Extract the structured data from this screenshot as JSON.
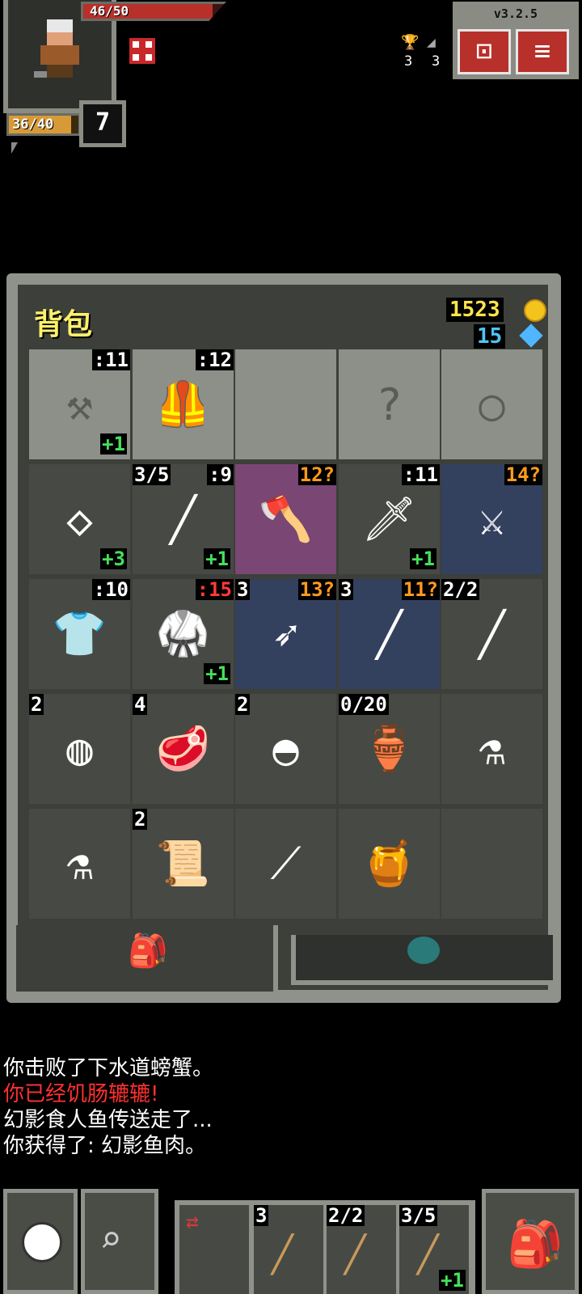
{
  "hud": {
    "hp": "46/50",
    "hp_fraction": 0.92,
    "xp": "36/40",
    "xp_fraction": 0.9,
    "depth": "7",
    "version": "v3.2.5",
    "stat_a_value": "3",
    "stat_b_value": "3",
    "icons": {
      "portrait": "hero-portrait",
      "buff": "hunger-buff-icon",
      "journal": "journal-icon",
      "menu": "menu-icon",
      "trophy": "trophy-icon",
      "stairs": "stairs-icon"
    }
  },
  "backpack": {
    "title": "背包",
    "gold": "1523",
    "gems": "15",
    "rows": [
      [
        {
          "name": "sickle",
          "icon": "⚒",
          "tr": ":11",
          "tr_color": "w",
          "br": "+1",
          "bg": "equip"
        },
        {
          "name": "leather-armor",
          "icon": "🦺",
          "tr": ":12",
          "tr_color": "w",
          "bg": "equip"
        },
        {
          "name": "empty-artifact",
          "icon": "",
          "bg": "equip"
        },
        {
          "name": "empty-misc",
          "icon": "?",
          "bg": "equip"
        },
        {
          "name": "empty-ring",
          "icon": "○",
          "bg": "equip"
        }
      ],
      [
        {
          "name": "ring",
          "icon": "◇",
          "br": "+3",
          "bg": "normal"
        },
        {
          "name": "staff",
          "icon": "╱",
          "tl": "3/5",
          "tr": ":9",
          "tr_color": "w",
          "br": "+1",
          "bg": "normal"
        },
        {
          "name": "hand-axe",
          "icon": "🪓",
          "tr": "12?",
          "tr_color": "o",
          "bg": "purple"
        },
        {
          "name": "shortsword",
          "icon": "🗡",
          "tr": ":11",
          "tr_color": "w",
          "br": "+1",
          "bg": "normal"
        },
        {
          "name": "scimitar",
          "icon": "⚔",
          "tr": "14?",
          "tr_color": "o",
          "bg": "blue"
        }
      ],
      [
        {
          "name": "cloth-armor",
          "icon": "👕",
          "tr": ":10",
          "tr_color": "w",
          "bg": "normal"
        },
        {
          "name": "scale-armor",
          "icon": "🥋",
          "tr": ":15",
          "tr_color": "r",
          "br": "+1",
          "bg": "normal"
        },
        {
          "name": "javelins",
          "icon": "➶",
          "tl": "3",
          "tr": "13?",
          "tr_color": "o",
          "bg": "blue"
        },
        {
          "name": "throwing-knives",
          "icon": "╱",
          "tl": "3",
          "tr": "11?",
          "tr_color": "o",
          "bg": "blue"
        },
        {
          "name": "darts",
          "icon": "╱",
          "tl": "2/2",
          "bg": "normal"
        }
      ],
      [
        {
          "name": "stones",
          "icon": "◍",
          "tl": "2",
          "bg": "normal"
        },
        {
          "name": "meat",
          "icon": "🥩",
          "tl": "4",
          "bg": "normal"
        },
        {
          "name": "ore",
          "icon": "◓",
          "tl": "2",
          "bg": "normal"
        },
        {
          "name": "waterskin",
          "icon": "🏺",
          "tl": "0/20",
          "bg": "normal"
        },
        {
          "name": "potion",
          "icon": "⚗",
          "bg": "normal"
        }
      ],
      [
        {
          "name": "empty-flask",
          "icon": "⚗",
          "bg": "normal"
        },
        {
          "name": "scroll",
          "icon": "📜",
          "tl": "2",
          "bg": "normal"
        },
        {
          "name": "wand",
          "icon": "⟋",
          "bg": "normal"
        },
        {
          "name": "honeypot",
          "icon": "🍯",
          "bg": "normal"
        },
        {
          "name": "empty-slot",
          "icon": "",
          "bg": "normal"
        }
      ]
    ]
  },
  "log": [
    {
      "text": "你击败了下水道螃蟹。",
      "color": "#ffffff"
    },
    {
      "text": "你已经饥肠辘辘!",
      "color": "#ff3030"
    },
    {
      "text": "幻影食人鱼传送走了...",
      "color": "#ffffff"
    },
    {
      "text": "你获得了: 幻影鱼肉。",
      "color": "#ffffff"
    }
  ],
  "toolbar": {
    "wait_icon": "clock-icon",
    "search_icon": "magnifier-icon",
    "swap_icon": "swap-icon",
    "inventory_icon": "backpack-icon",
    "quickslots": [
      {
        "name": "quickslot-knife",
        "tl": "3",
        "br": ""
      },
      {
        "name": "quickslot-dart",
        "tl": "2/2",
        "br": ""
      },
      {
        "name": "quickslot-staff",
        "tl": "3/5",
        "br": "+1"
      }
    ]
  }
}
